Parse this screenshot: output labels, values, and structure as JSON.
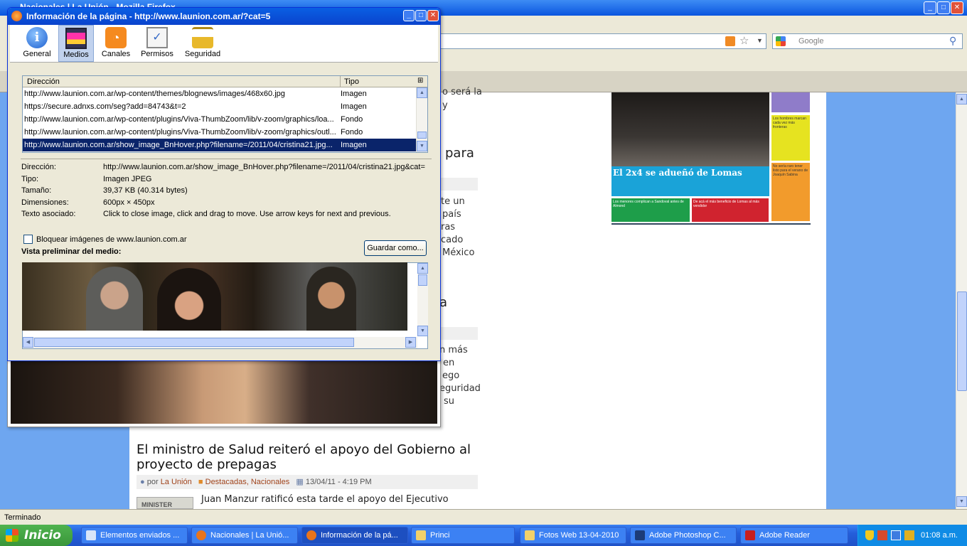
{
  "browser": {
    "title": "Nacionales | La Unión - Mozilla Firefox",
    "search_placeholder": "Google",
    "status": "Terminado"
  },
  "article": {
    "fragments": [
      "o será la",
      "y",
      "para",
      "te un",
      "país",
      "ras",
      "cado",
      "México",
      "a",
      "n más",
      "en",
      "ego",
      "eguridad",
      "su"
    ],
    "headline": "El ministro de Salud reiteró el apoyo del Gobierno al proyecto de prepagas",
    "meta_por": "por",
    "author": "La Unión",
    "categories": "Destacadas, Nacionales",
    "date": "13/04/11 - 4:19 PM",
    "lead": "Juan Manzur ratificó esta tarde el apoyo del Ejecutivo",
    "thumb_text": "MINISTER"
  },
  "newspaper": {
    "headline": "El 2x4 se adueñó de Lomas",
    "boxes": [
      "Los hombres marcan cada vez más fronteras",
      "No sería raro tener listo para el verano de Joaquín Sabina",
      "Los menores complican a Sandoval antes de Almond",
      "De acá el más beneficio de Lomas al más vendidor"
    ]
  },
  "dialog": {
    "title": "Información de la página - http://www.launion.com.ar/?cat=5",
    "tabs": [
      {
        "label": "General",
        "icon": "info-icon"
      },
      {
        "label": "Medios",
        "icon": "media-icon"
      },
      {
        "label": "Canales",
        "icon": "feed-icon"
      },
      {
        "label": "Permisos",
        "icon": "permissions-icon"
      },
      {
        "label": "Seguridad",
        "icon": "lock-icon"
      }
    ],
    "columns": {
      "address": "Dirección",
      "type": "Tipo"
    },
    "rows": [
      {
        "address": "http://www.launion.com.ar/wp-content/themes/blognews/images/468x60.jpg",
        "type": "Imagen"
      },
      {
        "address": "https://secure.adnxs.com/seg?add=84743&t=2",
        "type": "Imagen"
      },
      {
        "address": "http://www.launion.com.ar/wp-content/plugins/Viva-ThumbZoom/lib/v-zoom/graphics/loa...",
        "type": "Fondo"
      },
      {
        "address": "http://www.launion.com.ar/wp-content/plugins/Viva-ThumbZoom/lib/v-zoom/graphics/outl...",
        "type": "Fondo"
      },
      {
        "address": "http://www.launion.com.ar/show_image_BnHover.php?filename=/2011/04/cristina21.jpg...",
        "type": "Imagen"
      }
    ],
    "details": {
      "address_label": "Dirección:",
      "address": "http://www.launion.com.ar/show_image_BnHover.php?filename=/2011/04/cristina21.jpg&cat=",
      "type_label": "Tipo:",
      "type": "Imagen JPEG",
      "size_label": "Tamaño:",
      "size": "39,37 KB (40.314 bytes)",
      "dims_label": "Dimensiones:",
      "dims": "600px × 450px",
      "alt_label": "Texto asociado:",
      "alt": "Click to close image, click and drag to move. Use arrow keys for next and previous."
    },
    "block_label": "Bloquear imágenes de www.launion.com.ar",
    "save_label": "Guardar como...",
    "preview_label": "Vista preliminar del medio:"
  },
  "taskbar": {
    "start": "Inicio",
    "tasks": [
      "Elementos enviados ...",
      "Nacionales | La Unió...",
      "Información de la pá...",
      "Princi",
      "Fotos Web 13-04-2010",
      "Adobe Photoshop C...",
      "Adobe Reader"
    ],
    "clock": "01:08 a.m."
  }
}
